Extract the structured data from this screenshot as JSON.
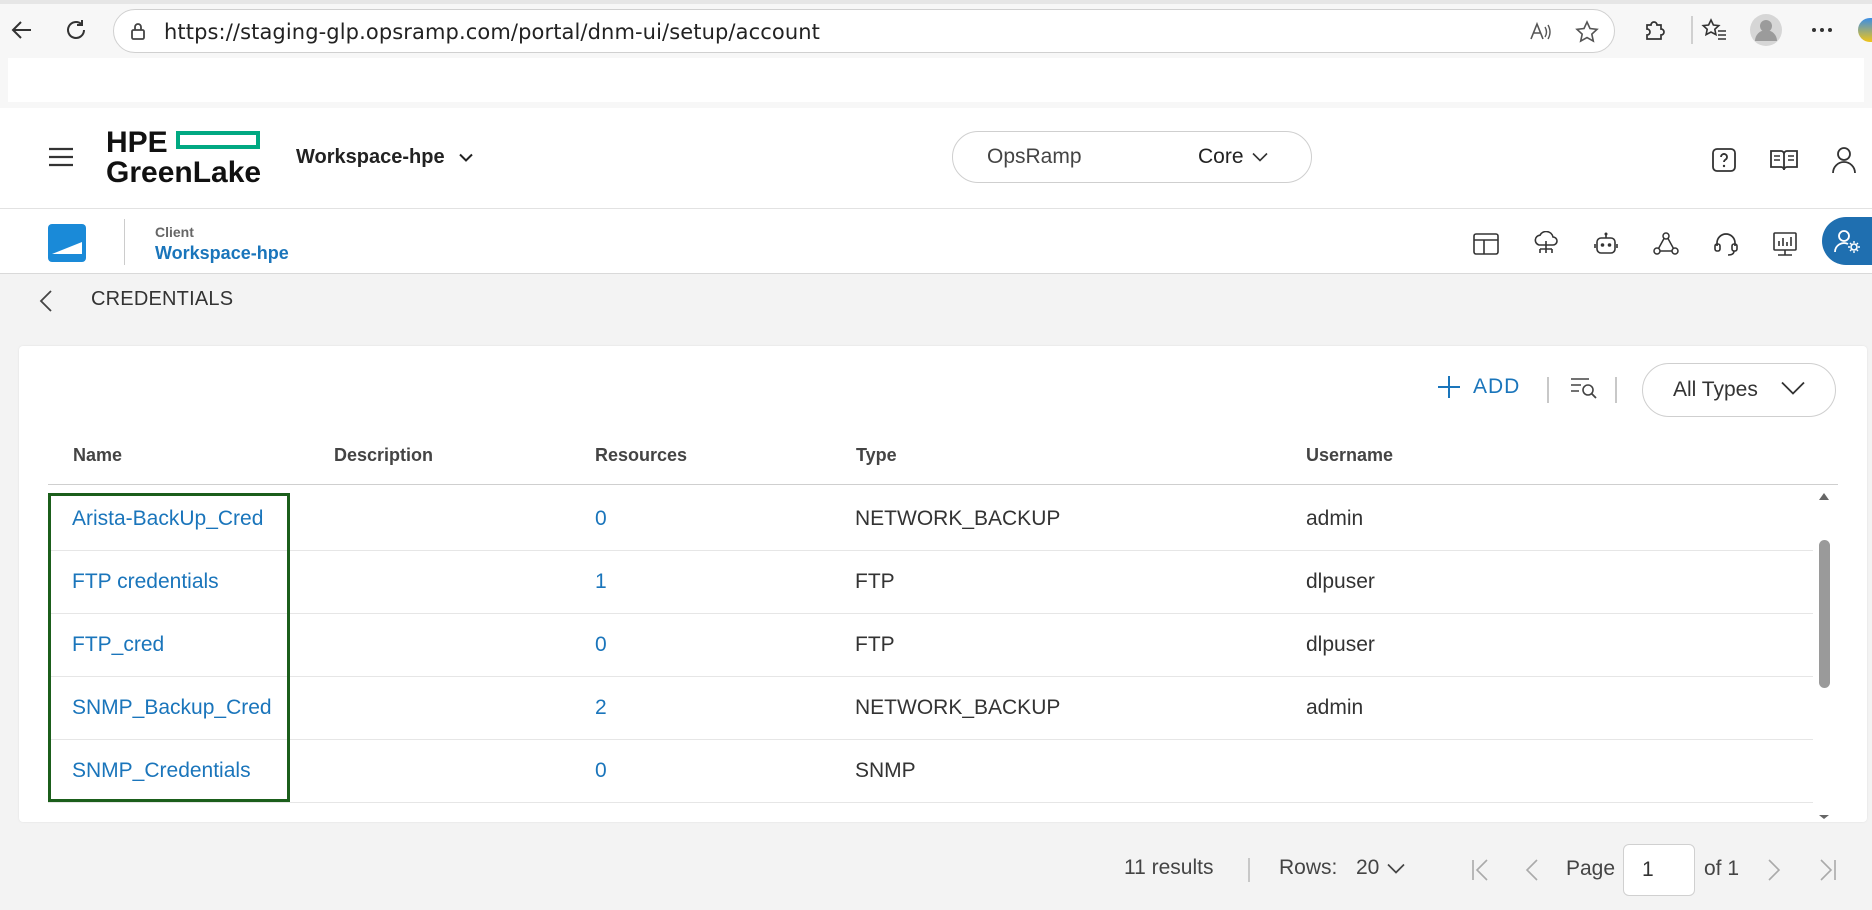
{
  "browser": {
    "url": "https://staging-glp.opsramp.com/portal/dnm-ui/setup/account"
  },
  "header": {
    "logo_line1": "HPE",
    "logo_line2": "GreenLake",
    "workspace": "Workspace-hpe",
    "product_label": "OpsRamp",
    "product_select": "Core"
  },
  "client": {
    "caption": "Client",
    "name": "Workspace-hpe"
  },
  "page": {
    "title": "CREDENTIALS",
    "add_label": "ADD",
    "type_filter": "All Types"
  },
  "table": {
    "columns": [
      "Name",
      "Description",
      "Resources",
      "Type",
      "Username"
    ],
    "rows": [
      {
        "name": "Arista-BackUp_Cred",
        "description": "",
        "resources": "0",
        "type": "NETWORK_BACKUP",
        "username": "admin"
      },
      {
        "name": "FTP credentials",
        "description": "",
        "resources": "1",
        "type": "FTP",
        "username": "dlpuser"
      },
      {
        "name": "FTP_cred",
        "description": "",
        "resources": "0",
        "type": "FTP",
        "username": "dlpuser"
      },
      {
        "name": "SNMP_Backup_Cred",
        "description": "",
        "resources": "2",
        "type": "NETWORK_BACKUP",
        "username": "admin"
      },
      {
        "name": "SNMP_Credentials",
        "description": "",
        "resources": "0",
        "type": "SNMP",
        "username": ""
      }
    ]
  },
  "pagination": {
    "results": "11 results",
    "rows_label": "Rows:",
    "rows_value": "20",
    "page_label": "Page",
    "page_value": "1",
    "of_label": "of 1"
  },
  "colors": {
    "accent": "#1a75bb",
    "brand_green": "#01a982",
    "highlight": "#1b5e1b"
  }
}
